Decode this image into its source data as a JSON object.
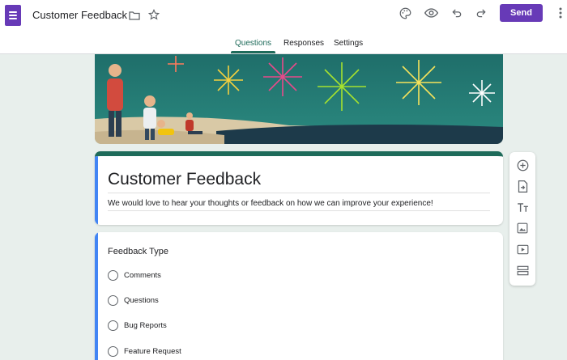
{
  "app": {
    "title": "Customer Feedback",
    "accent_color": "#673ab7",
    "theme_color": "#1e6b5a"
  },
  "header": {
    "send_label": "Send",
    "icons": [
      "folder-icon",
      "star-icon",
      "palette-icon",
      "preview-icon",
      "undo-icon",
      "redo-icon",
      "more-vert-icon"
    ]
  },
  "tabs": [
    {
      "label": "Questions",
      "active": true
    },
    {
      "label": "Responses",
      "active": false
    },
    {
      "label": "Settings",
      "active": false
    }
  ],
  "form": {
    "title": "Customer Feedback",
    "description": "We would love to hear your thoughts or feedback on how we can improve your experience!"
  },
  "question": {
    "title": "Feedback Type",
    "options": [
      "Comments",
      "Questions",
      "Bug Reports",
      "Feature Request"
    ]
  },
  "side_toolbar": {
    "icons": [
      "add-question-icon",
      "import-questions-icon",
      "add-title-icon",
      "add-image-icon",
      "add-video-icon",
      "add-section-icon"
    ]
  }
}
